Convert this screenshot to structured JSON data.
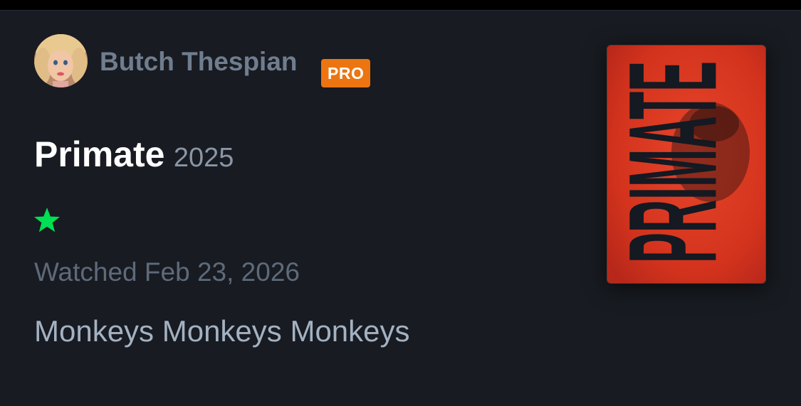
{
  "review": {
    "username": "Butch Thespian",
    "badge": "PRO",
    "film_title": "Primate",
    "film_year": "2025",
    "rating_stars": 1,
    "rating_icon": "star-icon",
    "watched_text": "Watched Feb 23, 2026",
    "body": "Monkeys Monkeys Monkeys",
    "poster_title": "PRIMATE"
  },
  "colors": {
    "background": "#181b21",
    "username": "#6f7d8f",
    "badge": "#ec7511",
    "star": "#00e054",
    "poster_red": "#d3331d"
  }
}
